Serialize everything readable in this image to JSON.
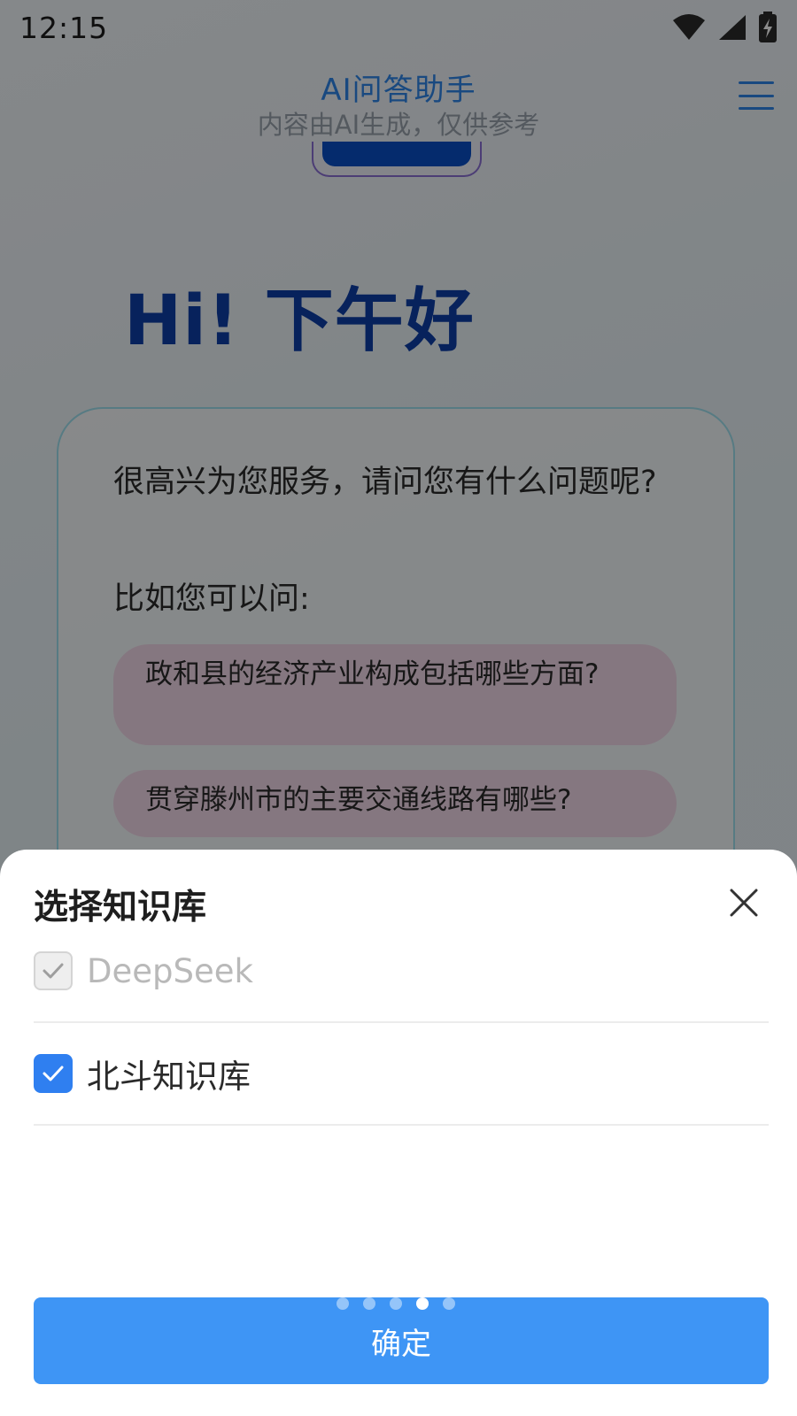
{
  "status_bar": {
    "time": "12:15",
    "icons": [
      "wifi-icon",
      "cellular-signal-icon",
      "battery-charging-icon"
    ]
  },
  "header": {
    "title": "AI问答助手",
    "subtitle": "内容由AI生成，仅供参考",
    "menu_icon": "menu-icon"
  },
  "main": {
    "greeting": "Hi! 下午好",
    "intro": "很高兴为您服务，请问您有什么问题呢?",
    "hint": "比如您可以问:",
    "suggestions": [
      "政和县的经济产业构成包括哪些方面?",
      "贯穿滕州市的主要交通线路有哪些?"
    ]
  },
  "sheet": {
    "title": "选择知识库",
    "close_icon": "close-icon",
    "options": [
      {
        "label": "DeepSeek",
        "checked": true,
        "disabled": true
      },
      {
        "label": "北斗知识库",
        "checked": true,
        "disabled": false
      }
    ],
    "confirm_label": "确定",
    "pager": {
      "count": 5,
      "active_index": 3
    }
  },
  "colors": {
    "accent": "#2f86ea",
    "greeting": "#0d3fa8",
    "checkbox_checked": "#2f7ff0",
    "confirm_button": "#3e95f5",
    "suggestion_bg": "#f3d9ea"
  }
}
